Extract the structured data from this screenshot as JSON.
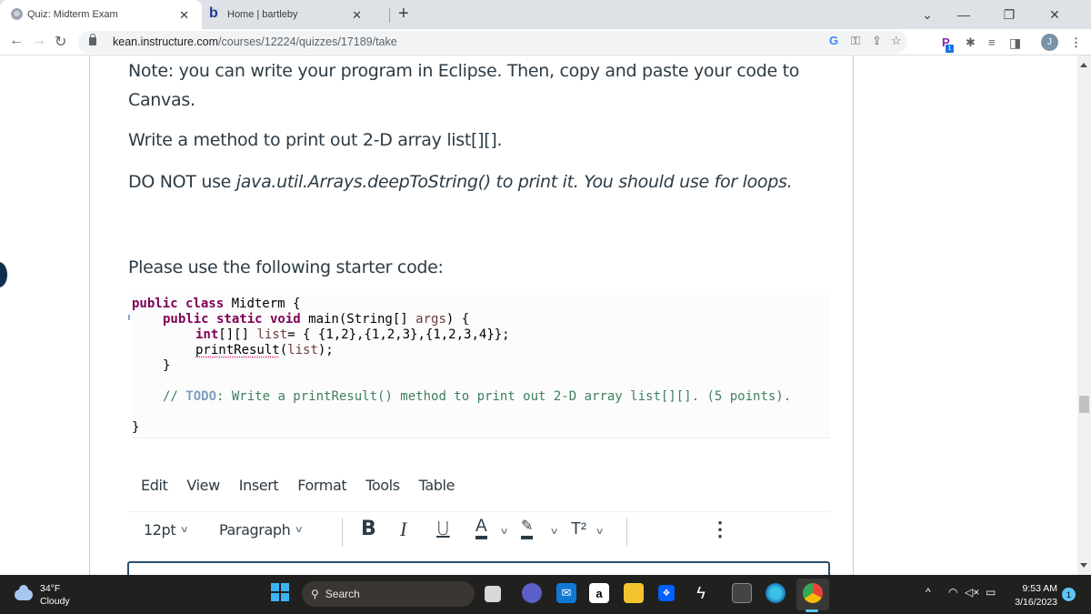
{
  "browser": {
    "tabs": [
      {
        "title": "Quiz: Midterm Exam",
        "active": true
      },
      {
        "title": "Home | bartleby",
        "active": false
      }
    ],
    "new_tab_label": "+",
    "url_host": "kean.instructure.com",
    "url_path": "/courses/12224/quizzes/17189/take",
    "profile_initial": "J",
    "extension_badge": "1",
    "window_controls": {
      "tab_search": "⌄",
      "minimize": "—",
      "restore": "❐",
      "close": "✕"
    }
  },
  "question": {
    "note_line1": "Note: you can write your program in Eclipse. Then, copy and paste your code to",
    "note_line2": "Canvas.",
    "instruction": "Write a method to print out 2-D array list[][].",
    "warning_prefix": "DO NOT use ",
    "warning_italic": "java.util.Arrays.deepToString() to print it. You should use for loops.",
    "starter_label": "Please use the following starter code:",
    "code": {
      "line1_kw": "public class",
      "line1_rest": " Midterm {",
      "line2_kw": "public static void",
      "line2_mid": " main(String[] ",
      "line2_param": "args",
      "line2_end": ") {",
      "line3_kw": "int",
      "line3_mid": "[][] ",
      "line3_var": "list",
      "line3_end": "= { {1,2},{1,2,3},{1,2,3,4}};",
      "line4_call": "printResult",
      "line4_open": "(",
      "line4_arg": "list",
      "line4_end": ");",
      "line5": "}",
      "comment_prefix": "// ",
      "comment_todo": "TODO",
      "comment_rest": ": Write a printResult() method to print out 2-D array list[][]. (5 points).",
      "line_close": "}"
    }
  },
  "editor": {
    "menu": [
      "Edit",
      "View",
      "Insert",
      "Format",
      "Tools",
      "Table"
    ],
    "font_size": "12pt",
    "block_format": "Paragraph",
    "bold": "B",
    "italic": "I",
    "underline": "U",
    "text_color": "A",
    "highlight": "✎",
    "superscript": "T²",
    "more": "⋮",
    "chevron": "∨"
  },
  "taskbar": {
    "temperature": "34°F",
    "weather": "Cloudy",
    "search_label": "Search",
    "time": "9:53 AM",
    "date": "3/16/2023",
    "notification_count": "1"
  },
  "colors": {
    "text_primary": "#2d3b45",
    "code_keyword": "#7f0055",
    "code_comment": "#3f7f5f",
    "editor_border": "#2b4d6e",
    "taskbar_bg": "#20201f"
  }
}
